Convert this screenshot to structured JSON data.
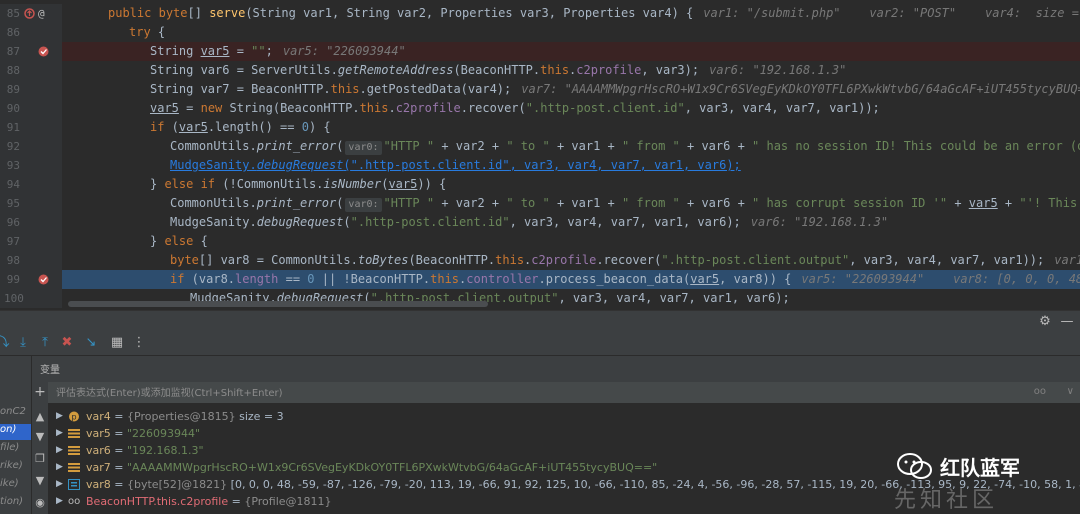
{
  "editor": {
    "lines": [
      {
        "n": "85"
      },
      {
        "n": "86"
      },
      {
        "n": "87"
      },
      {
        "n": "88"
      },
      {
        "n": "89"
      },
      {
        "n": "90"
      },
      {
        "n": "91"
      },
      {
        "n": "92"
      },
      {
        "n": "93"
      },
      {
        "n": "94"
      },
      {
        "n": "95"
      },
      {
        "n": "96"
      },
      {
        "n": "97"
      },
      {
        "n": "98"
      },
      {
        "n": "99"
      },
      {
        "n": "100"
      }
    ],
    "debug_values": {
      "l85": "var1: \"/submit.php\"    var2: \"POST\"    var4:  size = 3",
      "l87": "var5: \"226093944\"",
      "l88": "var6: \"192.168.1.3\"",
      "l89": "var7: \"AAAAMMWpgrHscRO+W1x9Cr6SVegEyKDkOY0TFL6PXwkWtvbG/64aGcAF+iUT455tycyBUQ==\"",
      "l95": "var6: \"192.168.1.3\"",
      "l98": "var1: \"/s",
      "l99": "var5: \"226093944\"    var8: [0, 0, 0, 48, -59, -8"
    },
    "strings": {
      "empty": "\"\"",
      "client_id": "\".http-post.client.id\"",
      "client_output": "\".http-post.client.output\"",
      "http": "\"HTTP \"",
      "to": "\" to \"",
      "from": "\" from \"",
      "no_session": "\" has no session ID! This could be an error (or mid",
      "corrupt": "\" has corrupt session ID '\"",
      "corrupt2": "\"'! This could b"
    }
  },
  "debugger": {
    "variables_title": "变量",
    "eval_placeholder": "评估表达式(Enter)或添加监视(Ctrl+Shift+Enter)",
    "eval_oo": "oo",
    "frames": [
      "onC2",
      "on)",
      "file)",
      "rike)",
      "ike)",
      "tion)"
    ],
    "variables": [
      {
        "name": "var4",
        "eq": " = ",
        "desc": "{Properties@1815}",
        "extra": "  size = 3",
        "icon": "p"
      },
      {
        "name": "var5",
        "eq": " = ",
        "desc": "",
        "extra": "\"226093944\"",
        "icon": "f"
      },
      {
        "name": "var6",
        "eq": " = ",
        "desc": "",
        "extra": "\"192.168.1.3\"",
        "icon": "f"
      },
      {
        "name": "var7",
        "eq": " = ",
        "desc": "",
        "extra": "\"AAAAMMWpgrHscRO+W1x9Cr6SVegEyKDkOY0TFL6PXwkWtvbG/64aGcAF+iUT455tycyBUQ==\"",
        "icon": "f"
      },
      {
        "name": "var8",
        "eq": " = ",
        "desc": "{byte[52]@1821}",
        "extra": " [0, 0, 0, 48, -59, -87, -126, -79, -20, 113, 19, -66, 91, 92, 125, 10, -66, -110, 85, -24, 4, -56, -96, -28, 57, -115, 19, 20, -66, -113, 95, 9, 22, -74, -10, 58, 1, 82, 26, 25, 64, 5",
        "icon": "a"
      },
      {
        "name": "BeaconHTTP.this.c2profile",
        "eq": " = ",
        "desc": "{Profile@1811}",
        "extra": "",
        "icon": "oo"
      }
    ]
  },
  "watermark": {
    "line1": "红队蓝军",
    "line2": "先知社区"
  },
  "colors": {
    "keyword": "#cc7832",
    "string": "#6a8759",
    "number": "#6897bb",
    "breakpoint": "#c75450",
    "exec_line": "#2d4d6e"
  }
}
